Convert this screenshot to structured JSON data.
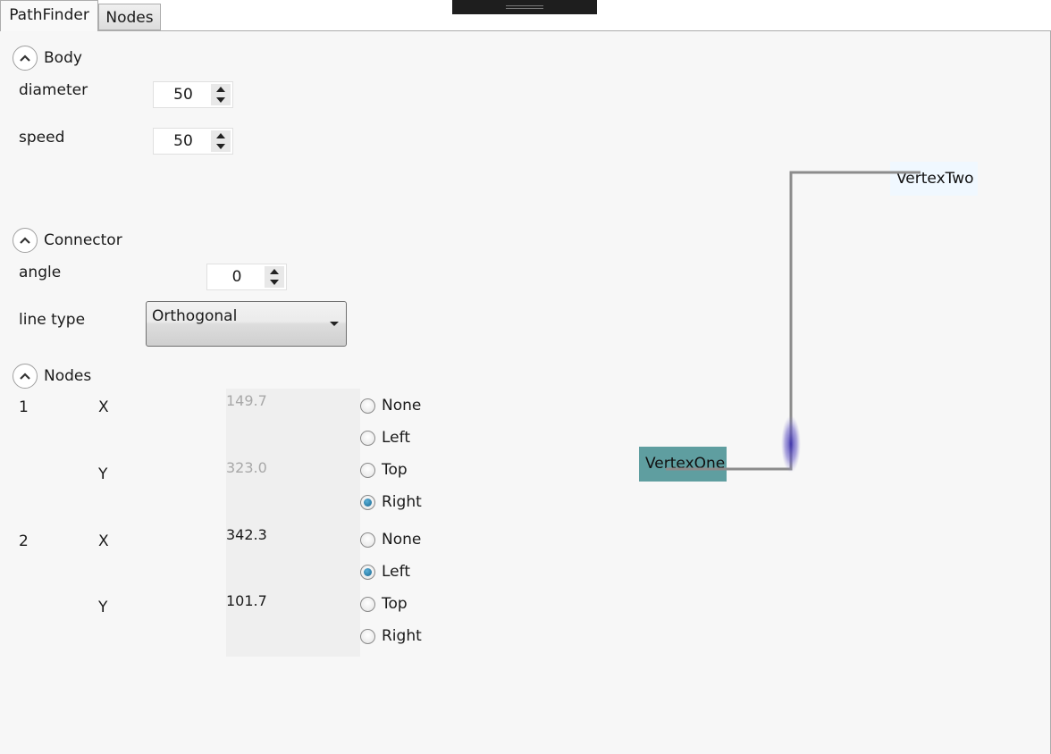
{
  "tabs": [
    "PathFinder",
    "Nodes"
  ],
  "body_section": {
    "title": "Body",
    "diameter_label": "diameter",
    "diameter_value": "50",
    "speed_label": "speed",
    "speed_value": "50"
  },
  "connector_section": {
    "title": "Connector",
    "angle_label": "angle",
    "angle_value": "0",
    "line_type_label": "line type",
    "line_type_value": "Orthogonal"
  },
  "nodes_section": {
    "title": "Nodes",
    "nodes": [
      {
        "index": "1",
        "x_label": "X",
        "x_value": "149.7",
        "y_label": "Y",
        "y_value": "323.0"
      },
      {
        "index": "2",
        "x_label": "X",
        "x_value": "342.3",
        "y_label": "Y",
        "y_value": "101.7"
      }
    ],
    "options": [
      "None",
      "Left",
      "Top",
      "Right"
    ],
    "node1_selected": "Right",
    "node2_selected": "Left"
  },
  "canvas": {
    "vertex_one": "VertexOne",
    "vertex_two": "VertexTwo"
  },
  "colors": {
    "vertex_one_fill": "#5f9ea0",
    "vertex_two_fill": "#f0f8ff",
    "connector_line": "#8c8c8c",
    "radio_selected": "#1b7fb3"
  }
}
